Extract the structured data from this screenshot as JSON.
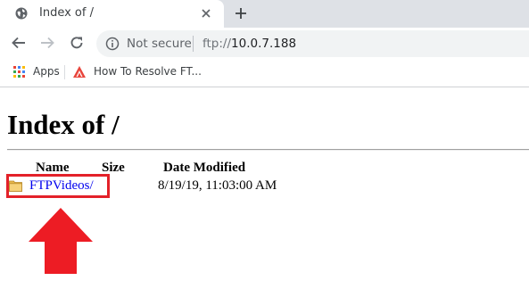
{
  "browser": {
    "tab": {
      "title": "Index of /"
    },
    "toolbar": {
      "security_label": "Not secure",
      "url_scheme": "ftp://",
      "url_host": "10.0.7.188"
    },
    "bookmarks": [
      {
        "label": "Apps",
        "icon": "apps-grid-icon"
      },
      {
        "label": "How To Resolve FT...",
        "icon": "bookmark-favicon-icon"
      }
    ]
  },
  "page": {
    "heading": "Index of /",
    "columns": {
      "name": "Name",
      "size": "Size",
      "date": "Date Modified"
    },
    "entries": [
      {
        "name": "FTPVideos/",
        "size": "",
        "date": "8/19/19, 11:03:00 AM",
        "icon": "folder-icon"
      }
    ]
  },
  "annotations": {
    "highlight_color": "#e32129",
    "arrow_color": "#e32129"
  }
}
